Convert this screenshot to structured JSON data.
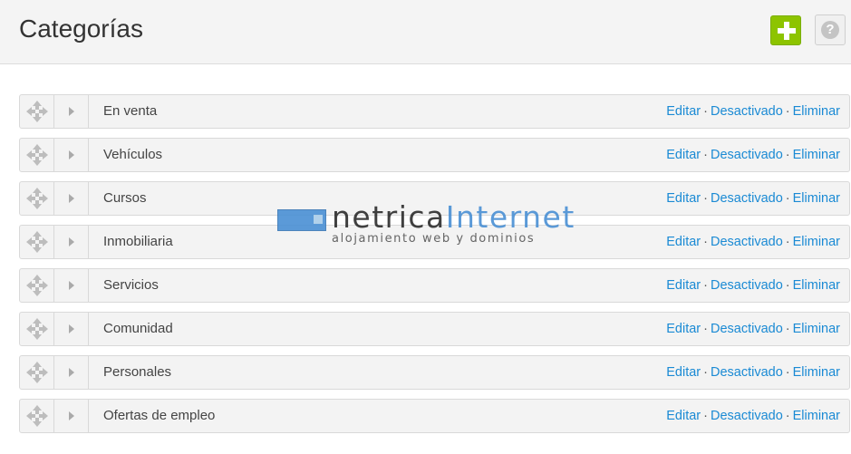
{
  "header": {
    "title": "Categorías",
    "add_icon": "plus-icon",
    "help_icon": "question-icon",
    "help_glyph": "?",
    "accent_color": "#8dc400"
  },
  "categories": [
    {
      "name": "En venta"
    },
    {
      "name": "Vehículos"
    },
    {
      "name": "Cursos"
    },
    {
      "name": "Inmobiliaria"
    },
    {
      "name": "Servicios"
    },
    {
      "name": "Comunidad"
    },
    {
      "name": "Personales"
    },
    {
      "name": "Ofertas de empleo"
    }
  ],
  "row_actions": {
    "edit": "Editar",
    "status": "Desactivado",
    "delete": "Eliminar",
    "separator": "·",
    "link_color": "#1a8ad4"
  },
  "row_icons": {
    "drag": "move-arrows-icon",
    "expand": "caret-right-icon"
  },
  "watermark": {
    "name_part1": "netrica",
    "name_part2": "Internet",
    "tagline": "alojamiento web y dominios"
  }
}
